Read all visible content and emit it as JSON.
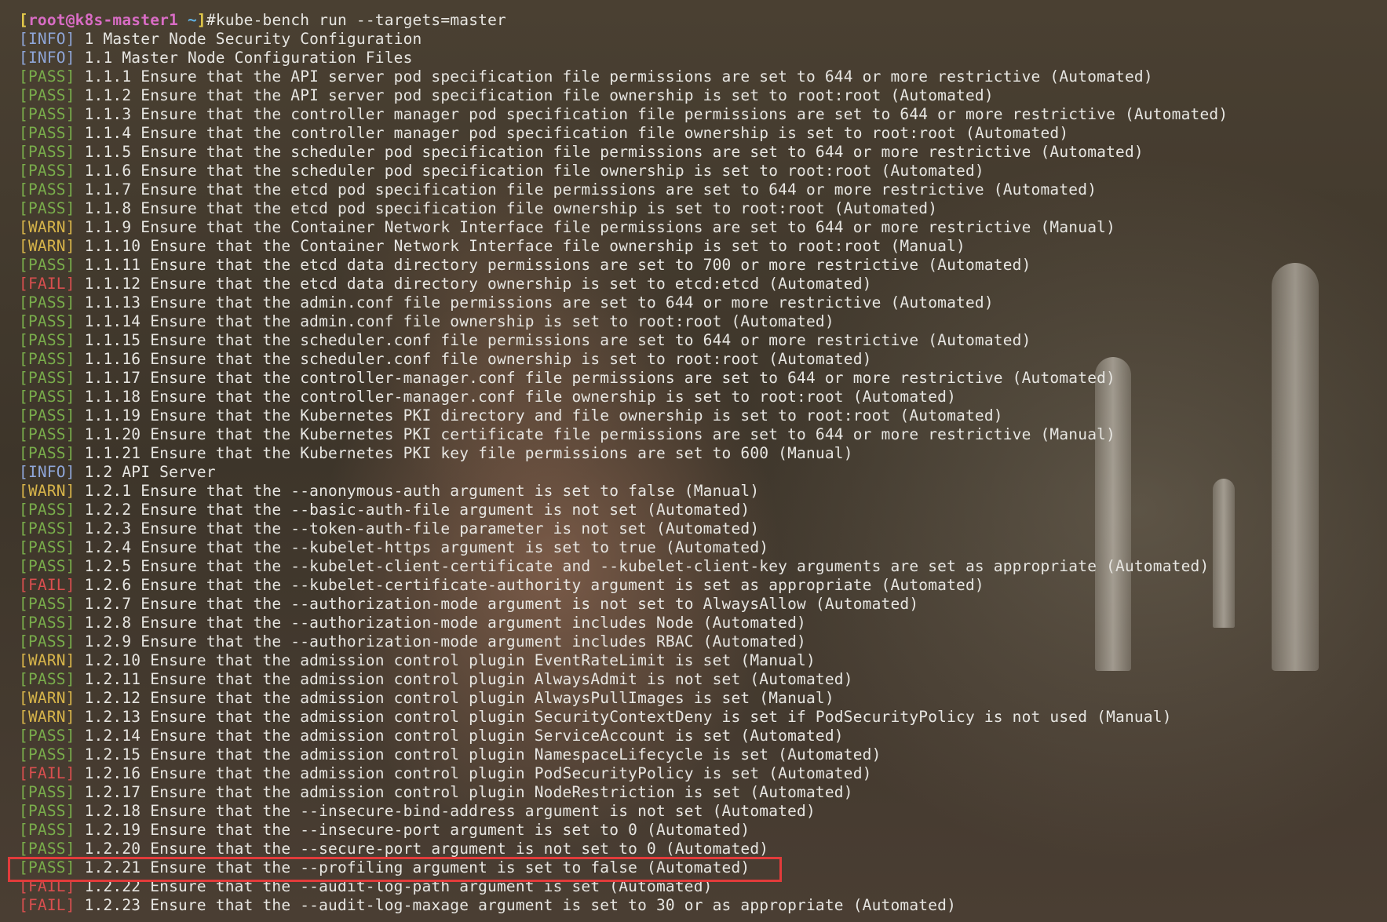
{
  "terminal": {
    "prompt": {
      "user": "root",
      "host": "k8s-master1",
      "path": "~",
      "command": "#kube-bench run --targets=master"
    },
    "lines": [
      {
        "tag": "INFO",
        "text": "1 Master Node Security Configuration"
      },
      {
        "tag": "INFO",
        "text": "1.1 Master Node Configuration Files"
      },
      {
        "tag": "PASS",
        "text": "1.1.1 Ensure that the API server pod specification file permissions are set to 644 or more restrictive (Automated)"
      },
      {
        "tag": "PASS",
        "text": "1.1.2 Ensure that the API server pod specification file ownership is set to root:root (Automated)"
      },
      {
        "tag": "PASS",
        "text": "1.1.3 Ensure that the controller manager pod specification file permissions are set to 644 or more restrictive (Automated)"
      },
      {
        "tag": "PASS",
        "text": "1.1.4 Ensure that the controller manager pod specification file ownership is set to root:root (Automated)"
      },
      {
        "tag": "PASS",
        "text": "1.1.5 Ensure that the scheduler pod specification file permissions are set to 644 or more restrictive (Automated)"
      },
      {
        "tag": "PASS",
        "text": "1.1.6 Ensure that the scheduler pod specification file ownership is set to root:root (Automated)"
      },
      {
        "tag": "PASS",
        "text": "1.1.7 Ensure that the etcd pod specification file permissions are set to 644 or more restrictive (Automated)"
      },
      {
        "tag": "PASS",
        "text": "1.1.8 Ensure that the etcd pod specification file ownership is set to root:root (Automated)"
      },
      {
        "tag": "WARN",
        "text": "1.1.9 Ensure that the Container Network Interface file permissions are set to 644 or more restrictive (Manual)"
      },
      {
        "tag": "WARN",
        "text": "1.1.10 Ensure that the Container Network Interface file ownership is set to root:root (Manual)"
      },
      {
        "tag": "PASS",
        "text": "1.1.11 Ensure that the etcd data directory permissions are set to 700 or more restrictive (Automated)"
      },
      {
        "tag": "FAIL",
        "text": "1.1.12 Ensure that the etcd data directory ownership is set to etcd:etcd (Automated)"
      },
      {
        "tag": "PASS",
        "text": "1.1.13 Ensure that the admin.conf file permissions are set to 644 or more restrictive (Automated)"
      },
      {
        "tag": "PASS",
        "text": "1.1.14 Ensure that the admin.conf file ownership is set to root:root (Automated)"
      },
      {
        "tag": "PASS",
        "text": "1.1.15 Ensure that the scheduler.conf file permissions are set to 644 or more restrictive (Automated)"
      },
      {
        "tag": "PASS",
        "text": "1.1.16 Ensure that the scheduler.conf file ownership is set to root:root (Automated)"
      },
      {
        "tag": "PASS",
        "text": "1.1.17 Ensure that the controller-manager.conf file permissions are set to 644 or more restrictive (Automated)"
      },
      {
        "tag": "PASS",
        "text": "1.1.18 Ensure that the controller-manager.conf file ownership is set to root:root (Automated)"
      },
      {
        "tag": "PASS",
        "text": "1.1.19 Ensure that the Kubernetes PKI directory and file ownership is set to root:root (Automated)"
      },
      {
        "tag": "PASS",
        "text": "1.1.20 Ensure that the Kubernetes PKI certificate file permissions are set to 644 or more restrictive (Manual)"
      },
      {
        "tag": "PASS",
        "text": "1.1.21 Ensure that the Kubernetes PKI key file permissions are set to 600 (Manual)"
      },
      {
        "tag": "INFO",
        "text": "1.2 API Server"
      },
      {
        "tag": "WARN",
        "text": "1.2.1 Ensure that the --anonymous-auth argument is set to false (Manual)"
      },
      {
        "tag": "PASS",
        "text": "1.2.2 Ensure that the --basic-auth-file argument is not set (Automated)"
      },
      {
        "tag": "PASS",
        "text": "1.2.3 Ensure that the --token-auth-file parameter is not set (Automated)"
      },
      {
        "tag": "PASS",
        "text": "1.2.4 Ensure that the --kubelet-https argument is set to true (Automated)"
      },
      {
        "tag": "PASS",
        "text": "1.2.5 Ensure that the --kubelet-client-certificate and --kubelet-client-key arguments are set as appropriate (Automated)"
      },
      {
        "tag": "FAIL",
        "text": "1.2.6 Ensure that the --kubelet-certificate-authority argument is set as appropriate (Automated)"
      },
      {
        "tag": "PASS",
        "text": "1.2.7 Ensure that the --authorization-mode argument is not set to AlwaysAllow (Automated)"
      },
      {
        "tag": "PASS",
        "text": "1.2.8 Ensure that the --authorization-mode argument includes Node (Automated)"
      },
      {
        "tag": "PASS",
        "text": "1.2.9 Ensure that the --authorization-mode argument includes RBAC (Automated)"
      },
      {
        "tag": "WARN",
        "text": "1.2.10 Ensure that the admission control plugin EventRateLimit is set (Manual)"
      },
      {
        "tag": "PASS",
        "text": "1.2.11 Ensure that the admission control plugin AlwaysAdmit is not set (Automated)"
      },
      {
        "tag": "WARN",
        "text": "1.2.12 Ensure that the admission control plugin AlwaysPullImages is set (Manual)"
      },
      {
        "tag": "WARN",
        "text": "1.2.13 Ensure that the admission control plugin SecurityContextDeny is set if PodSecurityPolicy is not used (Manual)"
      },
      {
        "tag": "PASS",
        "text": "1.2.14 Ensure that the admission control plugin ServiceAccount is set (Automated)"
      },
      {
        "tag": "PASS",
        "text": "1.2.15 Ensure that the admission control plugin NamespaceLifecycle is set (Automated)"
      },
      {
        "tag": "FAIL",
        "text": "1.2.16 Ensure that the admission control plugin PodSecurityPolicy is set (Automated)"
      },
      {
        "tag": "PASS",
        "text": "1.2.17 Ensure that the admission control plugin NodeRestriction is set (Automated)"
      },
      {
        "tag": "PASS",
        "text": "1.2.18 Ensure that the --insecure-bind-address argument is not set (Automated)"
      },
      {
        "tag": "PASS",
        "text": "1.2.19 Ensure that the --insecure-port argument is set to 0 (Automated)"
      },
      {
        "tag": "PASS",
        "text": "1.2.20 Ensure that the --secure-port argument is not set to 0 (Automated)"
      },
      {
        "tag": "PASS",
        "text": "1.2.21 Ensure that the --profiling argument is set to false (Automated)"
      },
      {
        "tag": "FAIL",
        "text": "1.2.22 Ensure that the --audit-log-path argument is set (Automated)"
      },
      {
        "tag": "FAIL",
        "text": "1.2.23 Ensure that the --audit-log-maxage argument is set to 30 or as appropriate (Automated)"
      }
    ],
    "highlighted_line": 44,
    "colors": {
      "info": "#8fa6d8",
      "pass": "#79ad4b",
      "warn": "#d8b54a",
      "fail": "#d94f4f",
      "highlight_box": "#e23b3b"
    }
  }
}
